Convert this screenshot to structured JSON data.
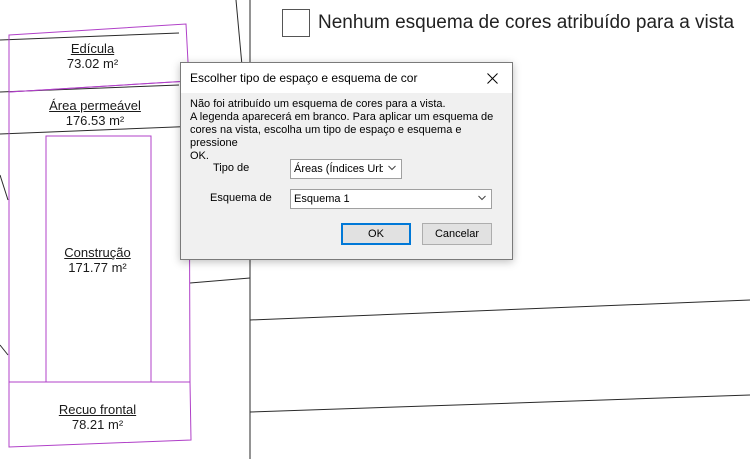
{
  "legend": {
    "text": "Nenhum esquema de cores atribuído para a vista"
  },
  "areas": [
    {
      "name": "Edícula",
      "value": "73.02 m²"
    },
    {
      "name": "Área permeável",
      "value": "176.53 m²"
    },
    {
      "name": "Construção",
      "value": "171.77 m²"
    },
    {
      "name": "Recuo frontal",
      "value": "78.21 m²"
    }
  ],
  "dialog": {
    "title": "Escolher tipo de espaço e esquema de cor",
    "message": "Não foi atribuído um esquema de cores para a vista.\nA legenda aparecerá em branco.  Para aplicar um esquema de\ncores na vista, escolha um tipo de espaço e esquema e pressione\nOK.",
    "type_label": "Tipo de",
    "type_value": "Áreas (Índices Urba",
    "scheme_label": "Esquema de",
    "scheme_value": "Esquema 1",
    "ok_label": "OK",
    "cancel_label": "Cancelar"
  },
  "colors": {
    "area_boundary": "#b040c8",
    "drawing_lines": "#2a2a2a",
    "dialog_background": "#f0f0f0",
    "default_button_border": "#0078d7"
  },
  "icons": {
    "close": "close-icon",
    "dropdown": "chevron-down-icon"
  }
}
